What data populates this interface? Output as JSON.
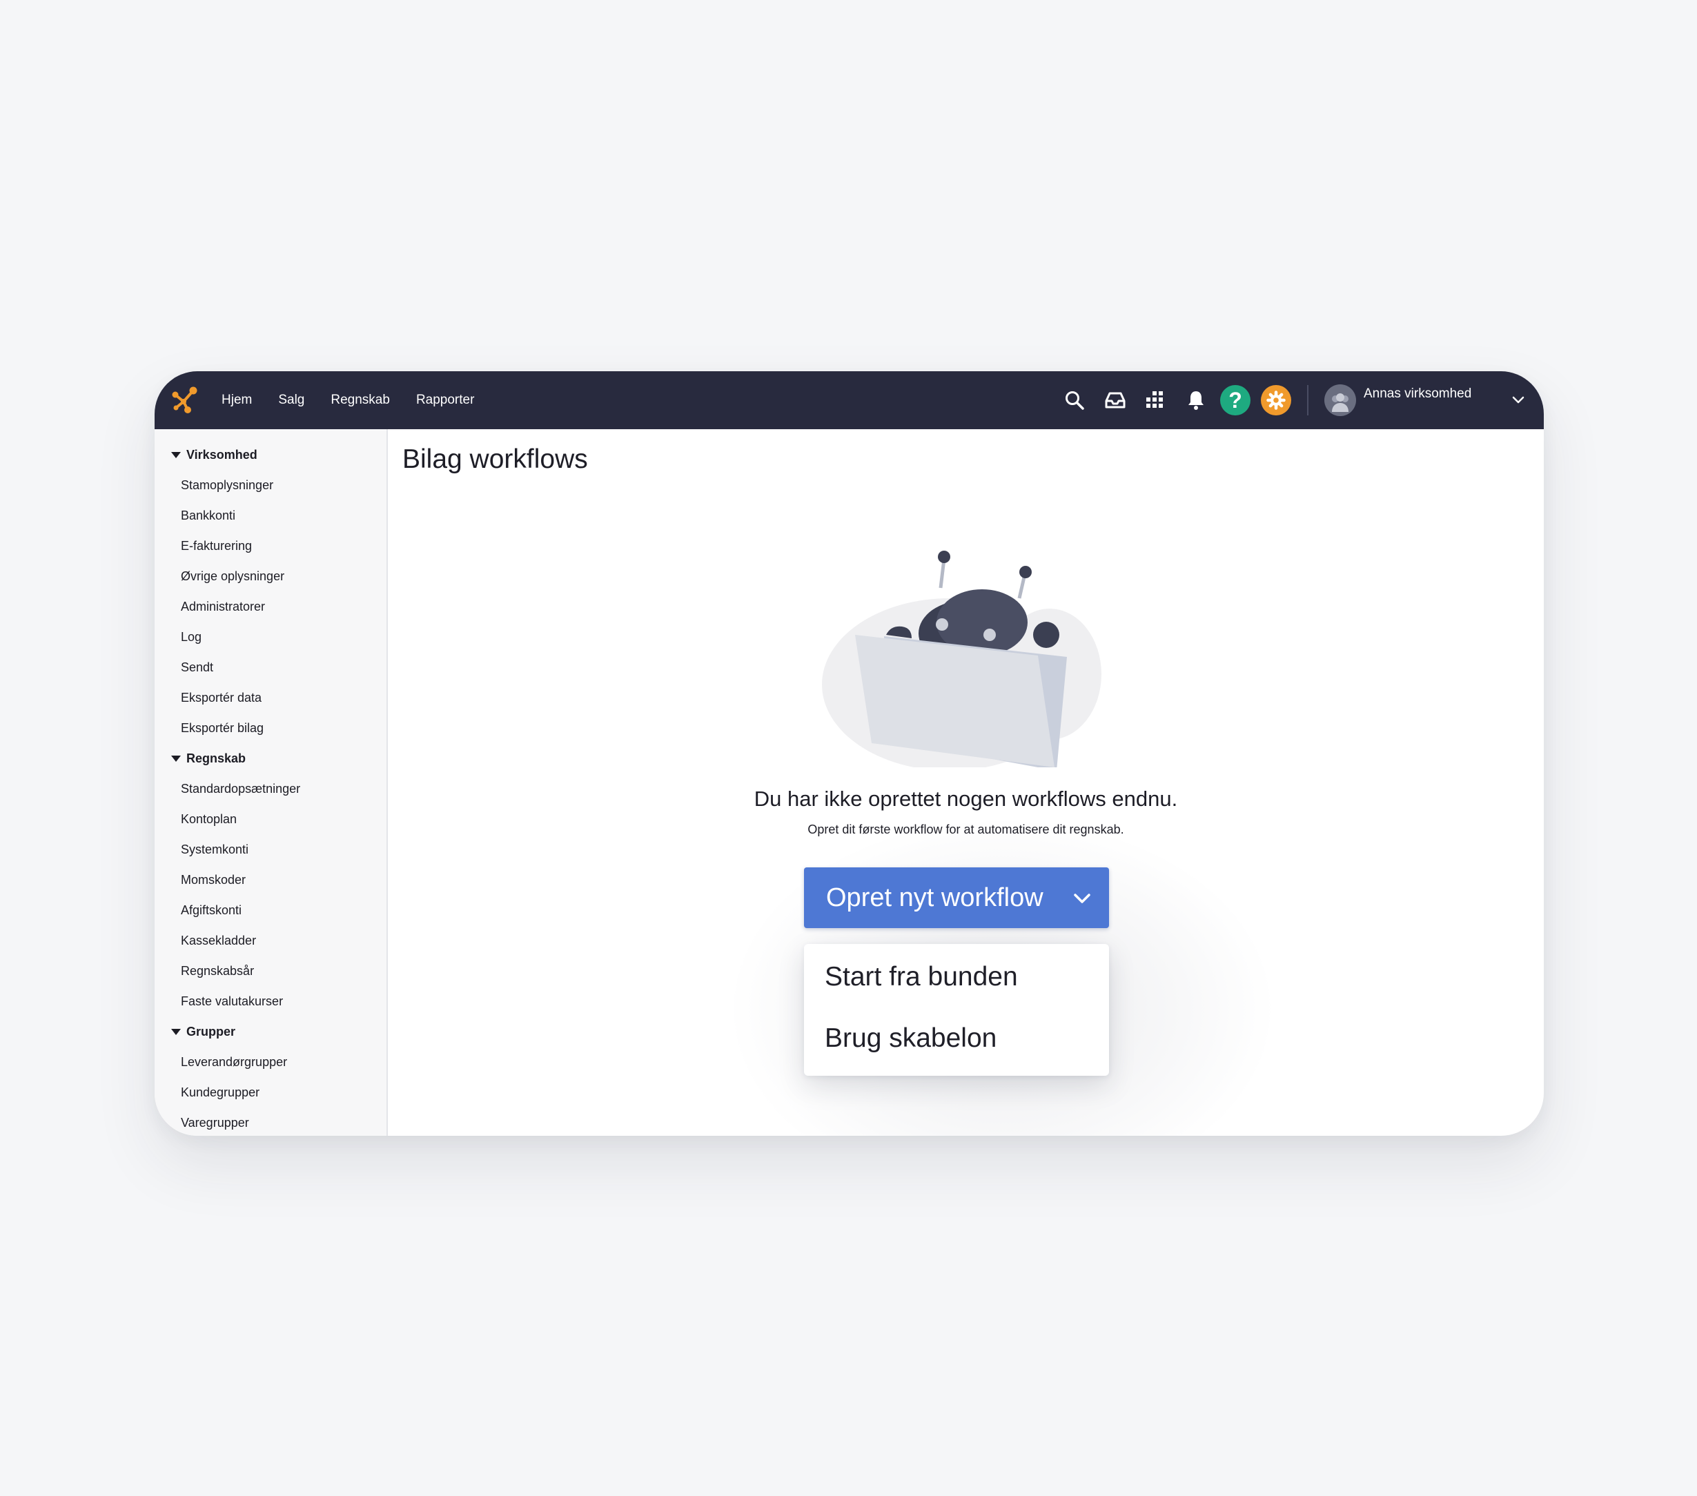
{
  "app": {
    "nav": [
      "Hjem",
      "Salg",
      "Regnskab",
      "Rapporter"
    ],
    "icons": [
      "search-icon",
      "inbox-icon",
      "apps-grid-icon",
      "bell-icon",
      "help-icon",
      "settings-icon"
    ],
    "help_color": "#1eaa80",
    "settings_color": "#f09a2c",
    "logo_color": "#f09a2c",
    "company": "Annas virksomhed"
  },
  "sidebar": {
    "sections": [
      {
        "title": "Virksomhed",
        "items": [
          "Stamoplysninger",
          "Bankkonti",
          "E-fakturering",
          "Øvrige oplysninger",
          "Administratorer",
          "Log",
          "Sendt",
          "Eksportér data",
          "Eksportér bilag"
        ]
      },
      {
        "title": "Regnskab",
        "items": [
          "Standardopsætninger",
          "Kontoplan",
          "Systemkonti",
          "Momskoder",
          "Afgiftskonti",
          "Kassekladder",
          "Regnskabsår",
          "Faste valutakurser"
        ]
      },
      {
        "title": "Grupper",
        "items": [
          "Leverandørgrupper",
          "Kundegrupper",
          "Varegrupper"
        ]
      }
    ]
  },
  "main": {
    "title": "Bilag workflows",
    "empty_title": "Du har ikke oprettet nogen workflows endnu.",
    "empty_subtitle": "Opret dit første workflow for at automatisere dit regnskab.",
    "button_label": "Opret nyt workflow",
    "button_color": "#4e78d4",
    "menu_options": [
      "Start fra bunden",
      "Brug skabelon"
    ]
  }
}
